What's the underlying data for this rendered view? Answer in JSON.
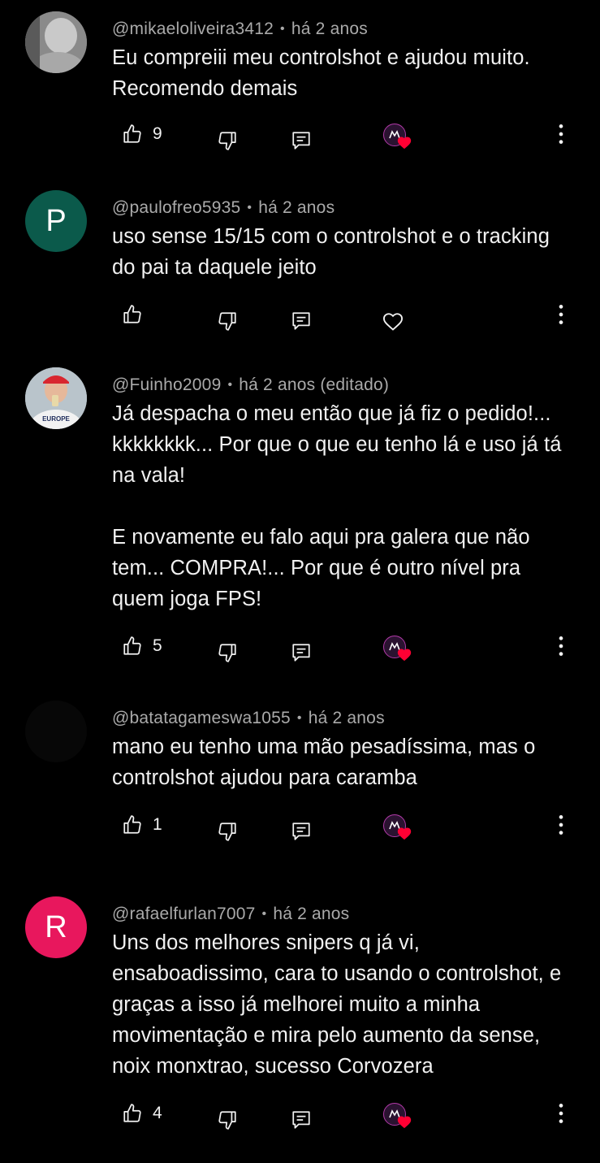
{
  "colors": {
    "background": "#000000",
    "text_primary": "#f1f1f1",
    "text_secondary": "#aaaaaa",
    "heart_red": "#ff0033"
  },
  "comments": [
    {
      "author": "@mikaeloliveira3412",
      "time": "há 2 anos",
      "text": "Eu compreiii meu controlshot e ajudou muito. Recomendo demais",
      "likes": "9",
      "avatar_type": "photo-gray",
      "creator_heart": true,
      "icons": [
        "thumb-up-icon",
        "thumb-down-icon",
        "reply-icon",
        "creator-heart-icon",
        "more-vert-icon"
      ]
    },
    {
      "author": "@paulofreo5935",
      "time": "há 2 anos",
      "text": "uso sense 15/15 com o controlshot e o tracking do pai ta daquele jeito",
      "likes": "",
      "avatar_type": "letter",
      "avatar_letter": "P",
      "avatar_color": "#0b5a4b",
      "creator_heart": false,
      "icons": [
        "thumb-up-icon",
        "thumb-down-icon",
        "reply-icon",
        "heart-outline-icon",
        "more-vert-icon"
      ]
    },
    {
      "author": "@Fuinho2009",
      "time": "há 2 anos (editado)",
      "text": "Já despacha o meu então que já fiz o pedido!... kkkkkkkk... Por que o que eu tenho lá e uso já tá na vala!\n\nE novamente eu falo aqui pra galera que não tem... COMPRA!... Por que é outro nível pra quem joga FPS!",
      "likes": "5",
      "avatar_type": "photo-person",
      "avatar_shirt_text": "EUROPE",
      "creator_heart": true,
      "icons": [
        "thumb-up-icon",
        "thumb-down-icon",
        "reply-icon",
        "creator-heart-icon",
        "more-vert-icon"
      ]
    },
    {
      "author": "@batatagameswa1055",
      "time": "há 2 anos",
      "text": "mano eu tenho uma mão pesadíssima, mas o controlshot ajudou para caramba",
      "likes": "1",
      "avatar_type": "dark",
      "creator_heart": true,
      "icons": [
        "thumb-up-icon",
        "thumb-down-icon",
        "reply-icon",
        "creator-heart-icon",
        "more-vert-icon"
      ]
    },
    {
      "author": "@rafaelfurlan7007",
      "time": "há 2 anos",
      "text": "Uns dos melhores snipers q já vi, ensaboadissimo, cara to usando o controlshot, e graças a isso já melhorei muito a minha movimentação e mira pelo aumento da sense, noix monxtrao, sucesso Corvozera",
      "likes": "4",
      "avatar_type": "letter",
      "avatar_letter": "R",
      "avatar_color": "#e8175d",
      "creator_heart": true,
      "icons": [
        "thumb-up-icon",
        "thumb-down-icon",
        "reply-icon",
        "creator-heart-icon",
        "more-vert-icon"
      ]
    }
  ]
}
